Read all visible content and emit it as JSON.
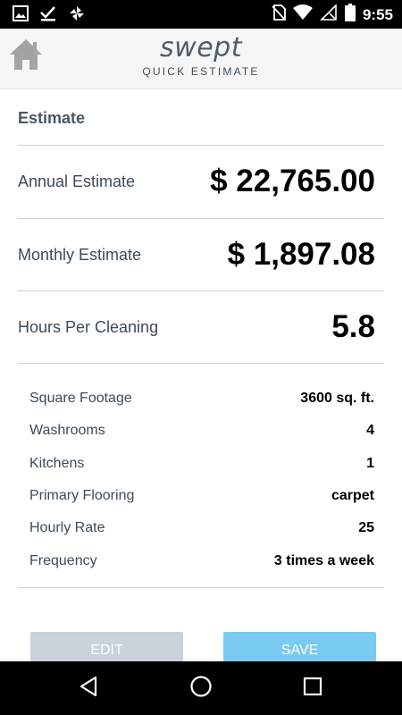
{
  "status_bar": {
    "time": "9:55",
    "left_icons": [
      "image-icon",
      "check-download-icon",
      "pinwheel-icon"
    ],
    "right_icons": [
      "no-sim-icon",
      "wifi-icon",
      "cellular-off-icon",
      "battery-icon"
    ]
  },
  "header": {
    "brand": "swept",
    "subtitle": "QUICK ESTIMATE",
    "home_icon": "home-icon"
  },
  "estimate": {
    "section_title": "Estimate",
    "annual_label": "Annual Estimate",
    "annual_value": "$ 22,765.00",
    "monthly_label": "Monthly Estimate",
    "monthly_value": "$ 1,897.08",
    "hours_label": "Hours Per Cleaning",
    "hours_value": "5.8"
  },
  "details": [
    {
      "label": "Square Footage",
      "value": "3600 sq. ft."
    },
    {
      "label": "Washrooms",
      "value": "4"
    },
    {
      "label": "Kitchens",
      "value": "1"
    },
    {
      "label": "Primary Flooring",
      "value": "carpet"
    },
    {
      "label": "Hourly Rate",
      "value": "25"
    },
    {
      "label": "Frequency",
      "value": "3 times a week"
    }
  ],
  "buttons": {
    "edit_label": "EDIT",
    "save_label": "SAVE"
  },
  "nav_bar": {
    "back_icon": "back-icon",
    "home_icon": "home-circle-icon",
    "recents_icon": "recents-icon"
  },
  "colors": {
    "header_bg": "#f6f6f6",
    "label_text": "#3c4b58",
    "edit_button": "#c9d1da",
    "save_button": "#79caf1"
  }
}
